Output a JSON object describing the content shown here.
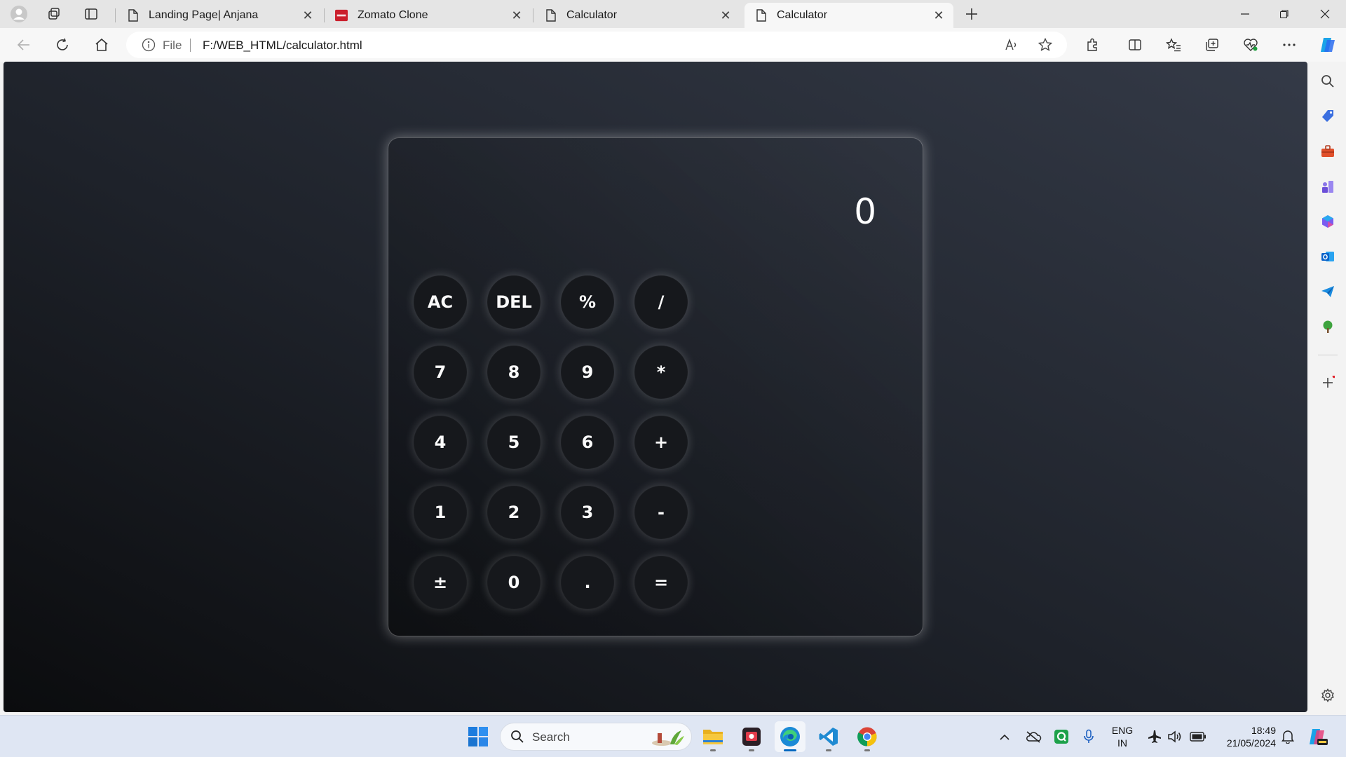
{
  "tabs": [
    {
      "title": "Landing Page| Anjana",
      "favicon": "page-icon"
    },
    {
      "title": "Zomato Clone",
      "favicon": "zomato-logo"
    },
    {
      "title": "Calculator",
      "favicon": "page-icon"
    },
    {
      "title": "Calculator",
      "favicon": "page-icon",
      "active": true
    }
  ],
  "address_bar": {
    "scheme_label": "File",
    "url": "F:/WEB_HTML/calculator.html"
  },
  "calculator": {
    "display": "0",
    "keys": [
      [
        "AC",
        "DEL",
        "%",
        "/"
      ],
      [
        "7",
        "8",
        "9",
        "*"
      ],
      [
        "4",
        "5",
        "6",
        "+"
      ],
      [
        "1",
        "2",
        "3",
        "-"
      ],
      [
        "±",
        "0",
        ".",
        "="
      ]
    ]
  },
  "taskbar": {
    "search_label": "Search",
    "language": "ENG",
    "region": "IN",
    "time": "18:49",
    "date": "21/05/2024"
  },
  "colors": {
    "accent": "#0067c0",
    "page_bg_dark": "#0b0c0e",
    "page_bg_light": "#343a47",
    "key_bg": "#16181c",
    "zomato_red": "#cb202d"
  }
}
